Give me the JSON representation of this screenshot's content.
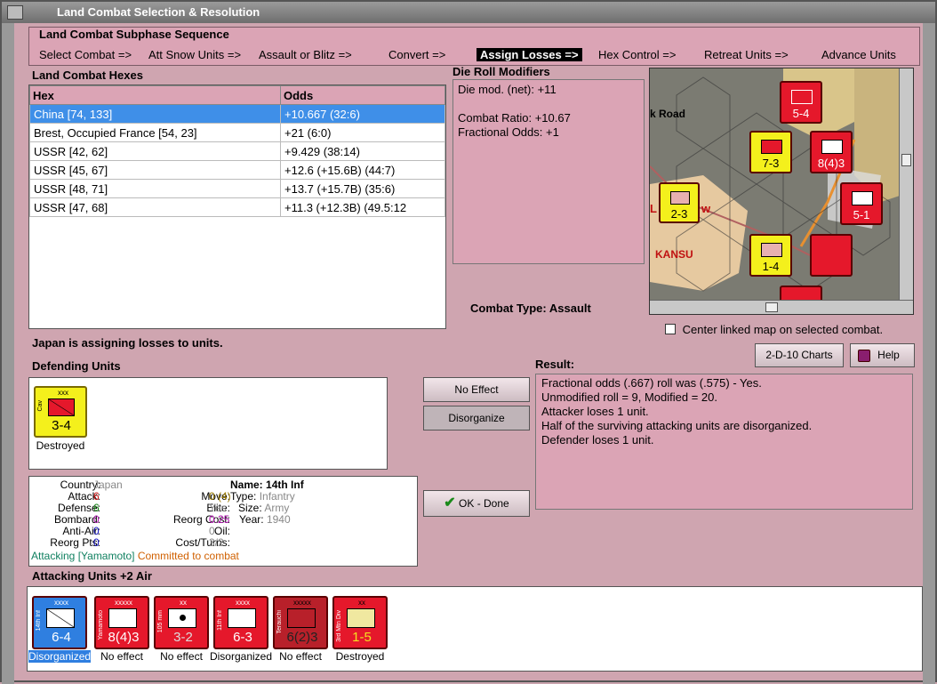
{
  "window": {
    "title": "Land Combat Selection & Resolution"
  },
  "subphase": {
    "heading": "Land Combat Subphase Sequence",
    "steps": [
      {
        "label": "Select Combat =>"
      },
      {
        "label": "Att Snow Units =>"
      },
      {
        "label": "Assault or Blitz =>"
      },
      {
        "label": "Convert =>"
      },
      {
        "label": "Assign Losses =>"
      },
      {
        "label": "Hex Control =>"
      },
      {
        "label": "Retreat Units =>"
      },
      {
        "label": "Advance Units"
      }
    ]
  },
  "hexes": {
    "heading": "Land Combat Hexes",
    "columns": [
      "Hex",
      "Odds"
    ],
    "rows": [
      {
        "hex": "China [74, 133]",
        "odds": "+10.667 (32:6)"
      },
      {
        "hex": "Brest, Occupied France [54, 23]",
        "odds": "+21 (6:0)"
      },
      {
        "hex": "USSR [42, 62]",
        "odds": "+9.429 (38:14)"
      },
      {
        "hex": "USSR [45, 67]",
        "odds": "+12.6 (+15.6B) (44:7)"
      },
      {
        "hex": "USSR [48, 71]",
        "odds": "+13.7 (+15.7B) (35:6)"
      },
      {
        "hex": "USSR [47, 68]",
        "odds": "+11.3 (+12.3B) (49.5:12"
      }
    ]
  },
  "die_roll": {
    "heading": "Die Roll Modifiers",
    "line1": "Die mod. (net): +11",
    "line2": "Combat Ratio: +10.67",
    "line3": "Fractional Odds: +1"
  },
  "combat_type": {
    "label": "Combat Type:",
    "value": "Assault"
  },
  "map": {
    "road_label": "k Road",
    "kansu": "KANSU",
    "partial": "w",
    "partial_left": "L"
  },
  "center_map": {
    "label": "Center linked map on selected combat."
  },
  "status": "Japan is assigning losses to units.",
  "defending": {
    "heading": "Defending Units",
    "units": [
      {
        "size": "xxx",
        "side": "Cav",
        "value": "3-4",
        "caption": "Destroyed"
      }
    ]
  },
  "buttons": {
    "no_effect": "No Effect",
    "disorganize": "Disorganize",
    "ok_done": "OK - Done",
    "charts": "2-D-10 Charts",
    "help": "Help"
  },
  "result": {
    "heading": "Result:",
    "lines": [
      "Fractional odds (.667) roll was (.575)  - Yes.",
      "Unmodified roll = 9, Modified = 20.",
      "Attacker loses 1 unit.",
      "Half of the surviving attacking units are disorganized.",
      "Defender loses 1 unit."
    ]
  },
  "details": {
    "country_l": "Country:",
    "country_v": "Japan",
    "name_l": "Name:",
    "name_v": "14th Inf",
    "attack_l": "Attack:",
    "attack_v": "6",
    "move_l": "Move:",
    "move_v": "0 (4)",
    "type_l": "Type:",
    "type_v": "Infantry",
    "defense_l": "Defense:",
    "defense_v": "6",
    "elite_l": "Elite:",
    "elite_v": "Yes",
    "size_l": "Size:",
    "size_v": "Army",
    "bombard_l": "Bombard:",
    "bombard_v": "0",
    "reorg_l": "Reorg Cost:",
    "reorg_v": "0.25",
    "year_l": "Year:",
    "year_v": "1940",
    "aa_l": "Anti-Air:",
    "aa_v": "0",
    "oil_l": "Oil:",
    "oil_v": "0",
    "reorgpts_l": "Reorg Pts:",
    "reorgpts_v": "0",
    "cost_l": "Cost/Turns:",
    "cost_v": "3/2",
    "attacking": "Attacking [Yamamoto]",
    "committed": "Committed to combat"
  },
  "attacking": {
    "heading": "Attacking Units +2 Air",
    "units": [
      {
        "size": "xxxx",
        "side": "14th Inf",
        "value": "6-4",
        "caption": "Disorganized"
      },
      {
        "size": "xxxxx",
        "side": "Yamamoto",
        "value": "8(4)3",
        "caption": "No effect"
      },
      {
        "size": "xx",
        "side": "105 mm",
        "value": "3-2",
        "caption": "No effect"
      },
      {
        "size": "xxxx",
        "side": "11th Inf",
        "value": "6-3",
        "caption": "Disorganized"
      },
      {
        "size": "xxxxx",
        "side": "Terauchi",
        "value": "6(2)3",
        "caption": "No effect"
      },
      {
        "size": "xx",
        "side": "3rd Mtn Div",
        "value": "1-5",
        "caption": "Destroyed"
      }
    ]
  },
  "map_units": [
    {
      "value": "5-4"
    },
    {
      "value": "7-3"
    },
    {
      "value": "8(4)3"
    },
    {
      "value": "2-3"
    },
    {
      "value": "5-1"
    },
    {
      "value": "1-4"
    }
  ],
  "colors": {
    "pink": "#dba4b5",
    "red": "#e5182b",
    "yellow": "#f4f01c",
    "selected": "#3f8fe8"
  }
}
